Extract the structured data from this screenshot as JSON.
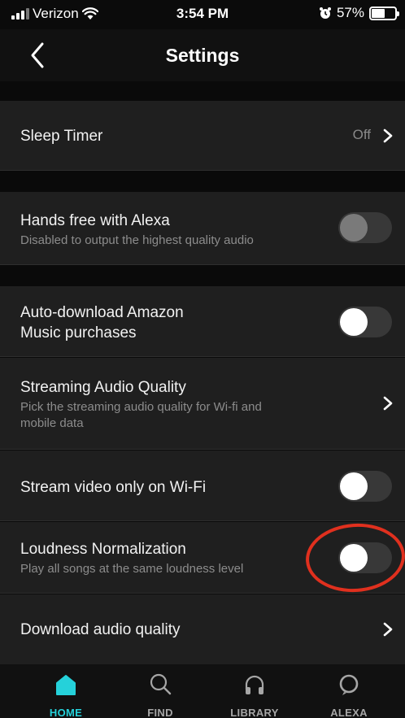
{
  "status_bar": {
    "carrier": "Verizon",
    "time": "3:54 PM",
    "battery": "57%",
    "battery_level": 0.57
  },
  "header": {
    "title": "Settings"
  },
  "settings": {
    "sleep_timer": {
      "label": "Sleep Timer",
      "value": "Off"
    },
    "hands_free": {
      "label": "Hands free with Alexa",
      "sub": "Disabled to output the highest quality audio",
      "enabled": false,
      "disabled": true
    },
    "auto_download": {
      "label_line1": "Auto-download Amazon",
      "label_line2": "Music purchases",
      "enabled": false
    },
    "streaming_quality": {
      "label": "Streaming Audio Quality",
      "sub_line1": "Pick the streaming audio quality for Wi-fi and",
      "sub_line2": "mobile data"
    },
    "stream_video": {
      "label": "Stream video only on Wi-Fi",
      "enabled": false
    },
    "loudness": {
      "label": "Loudness Normalization",
      "sub": "Play all songs at the same loudness level",
      "enabled": false
    },
    "download_quality": {
      "label": "Download audio quality"
    }
  },
  "tabs": [
    {
      "label": "HOME",
      "active": true
    },
    {
      "label": "FIND",
      "active": false
    },
    {
      "label": "LIBRARY",
      "active": false
    },
    {
      "label": "ALEXA",
      "active": false
    }
  ],
  "colors": {
    "accent": "#25d1da",
    "annotation_ring": "#e0301e",
    "row_background": "#1f1f1f"
  }
}
